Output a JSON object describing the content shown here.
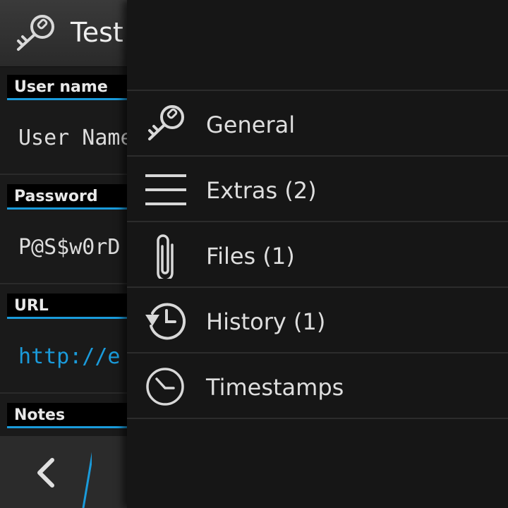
{
  "entry": {
    "title": "Test",
    "fields": [
      {
        "label": "User name",
        "value": "User Name"
      },
      {
        "label": "Password",
        "value": "P@S$w0rD"
      },
      {
        "label": "URL",
        "value": "http://e"
      },
      {
        "label": "Notes",
        "value": ""
      }
    ]
  },
  "menu": {
    "items": [
      {
        "label": "General",
        "icon": "key-icon"
      },
      {
        "label": "Extras (2)",
        "icon": "list-icon"
      },
      {
        "label": "Files (1)",
        "icon": "paperclip-icon"
      },
      {
        "label": "History (1)",
        "icon": "history-icon"
      },
      {
        "label": "Timestamps",
        "icon": "clock-icon"
      }
    ]
  },
  "colors": {
    "accent": "#1a9bdb",
    "drawer_bg": "#161616",
    "background": "#1a1a1a"
  }
}
